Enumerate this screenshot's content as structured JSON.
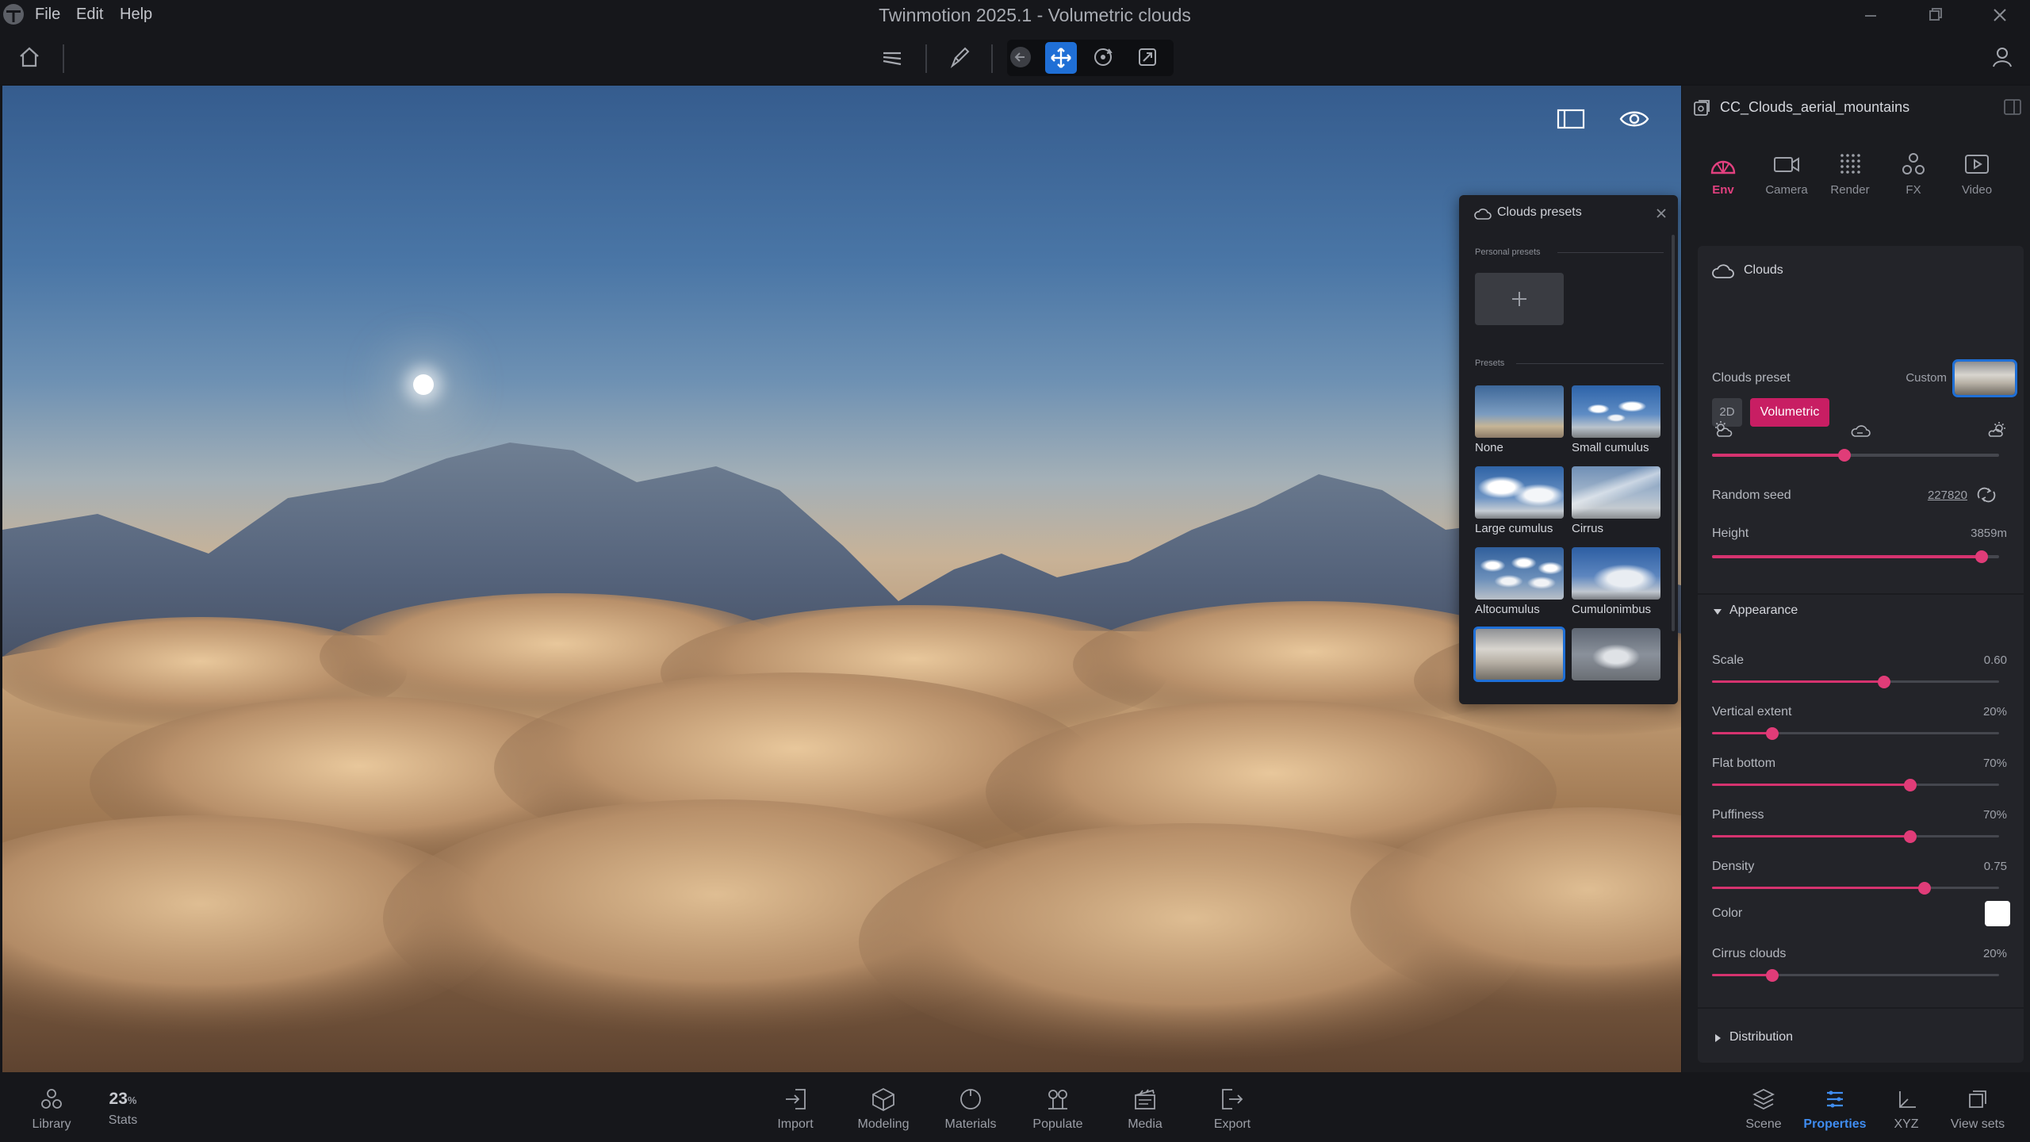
{
  "window": {
    "title": "Twinmotion 2025.1 - Volumetric clouds",
    "menu": [
      "File",
      "Edit",
      "Help"
    ]
  },
  "presets_panel": {
    "title": "Clouds presets",
    "personal_section": "Personal presets",
    "presets_section": "Presets",
    "items": [
      {
        "label": "None",
        "icon": "clear-sky-thumbnail"
      },
      {
        "label": "Small cumulus",
        "icon": "small-cumulus-thumbnail"
      },
      {
        "label": "Large cumulus",
        "icon": "large-cumulus-thumbnail"
      },
      {
        "label": "Cirrus",
        "icon": "cirrus-thumbnail"
      },
      {
        "label": "Altocumulus",
        "icon": "altocumulus-thumbnail"
      },
      {
        "label": "Cumulonimbus",
        "icon": "cumulonimbus-thumbnail"
      }
    ]
  },
  "right_panel": {
    "document_name": "CC_Clouds_aerial_mountains",
    "tabs": [
      {
        "label": "Env",
        "icon": "env-icon",
        "active": true
      },
      {
        "label": "Camera",
        "icon": "camera-icon",
        "active": false
      },
      {
        "label": "Render",
        "icon": "render-icon",
        "active": false
      },
      {
        "label": "FX",
        "icon": "fx-icon",
        "active": false
      },
      {
        "label": "Video",
        "icon": "video-icon",
        "active": false
      }
    ],
    "section_title": "Clouds",
    "mode_2d": "2D",
    "mode_volumetric": "Volumetric",
    "clouds_preset_label": "Clouds preset",
    "clouds_preset_value": "Custom",
    "coverage_level": 0.46,
    "random_seed_label": "Random seed",
    "random_seed_value": "227820",
    "height_label": "Height",
    "height_value": "3859m",
    "height_level": 0.94,
    "appearance_label": "Appearance",
    "appearance_sliders": [
      {
        "label": "Scale",
        "value": "0.60",
        "level": 0.6
      },
      {
        "label": "Vertical extent",
        "value": "20%",
        "level": 0.21
      },
      {
        "label": "Flat bottom",
        "value": "70%",
        "level": 0.69
      },
      {
        "label": "Puffiness",
        "value": "70%",
        "level": 0.69
      },
      {
        "label": "Density",
        "value": "0.75",
        "level": 0.74
      }
    ],
    "color_label": "Color",
    "color_value": "#ffffff",
    "cirrus_label": "Cirrus clouds",
    "cirrus_value": "20%",
    "cirrus_level": 0.21,
    "distribution_label": "Distribution"
  },
  "bottom_bar": {
    "library": "Library",
    "stats_value": "23",
    "stats_unit": "%",
    "stats": "Stats",
    "center": [
      "Import",
      "Modeling",
      "Materials",
      "Populate",
      "Media",
      "Export"
    ],
    "right": [
      "Scene",
      "Properties",
      "XYZ",
      "View sets"
    ],
    "active": "Properties"
  },
  "colors": {
    "accent_pink": "#c81e63",
    "accent_blue": "#1f6fd6",
    "panel_bg": "#1b1c20"
  }
}
